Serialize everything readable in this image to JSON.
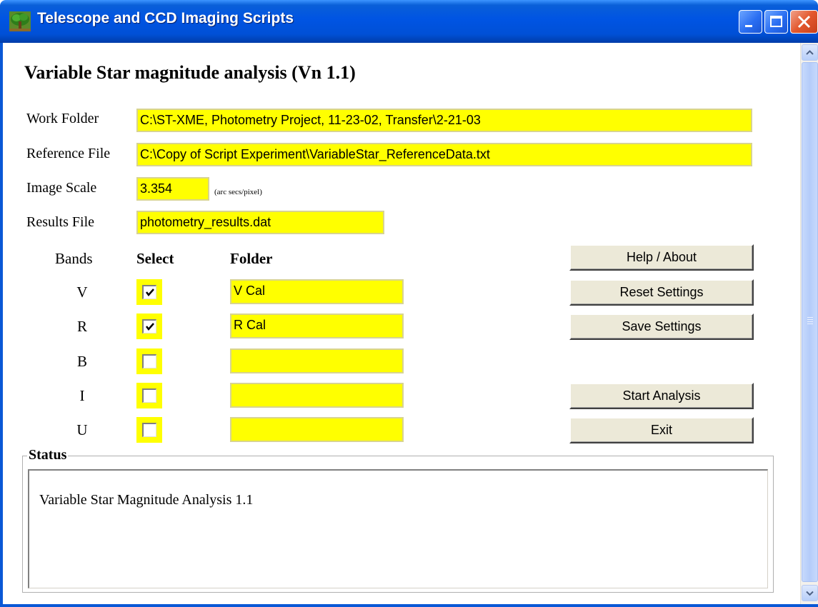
{
  "window": {
    "title": "Telescope and CCD Imaging Scripts"
  },
  "app": {
    "heading": "Variable Star magnitude analysis (Vn 1.1)"
  },
  "fields": {
    "work_folder_label": "Work Folder",
    "work_folder_value": "C:\\ST-XME, Photometry Project, 11-23-02, Transfer\\2-21-03",
    "reference_file_label": "Reference File",
    "reference_file_value": "C:\\Copy of Script Experiment\\VariableStar_ReferenceData.txt",
    "image_scale_label": "Image Scale",
    "image_scale_value": "3.354",
    "image_scale_unit": "(arc secs/pixel)",
    "results_file_label": "Results File",
    "results_file_value": "photometry_results.dat"
  },
  "bands_table": {
    "headers": {
      "bands": "Bands",
      "select": "Select",
      "folder": "Folder"
    },
    "rows": [
      {
        "band": "V",
        "selected": true,
        "folder": "V Cal"
      },
      {
        "band": "R",
        "selected": true,
        "folder": "R Cal"
      },
      {
        "band": "B",
        "selected": false,
        "folder": ""
      },
      {
        "band": "I",
        "selected": false,
        "folder": ""
      },
      {
        "band": "U",
        "selected": false,
        "folder": ""
      }
    ]
  },
  "buttons": {
    "help": "Help / About",
    "reset": "Reset Settings",
    "save": "Save Settings",
    "start": "Start Analysis",
    "exit": "Exit"
  },
  "status": {
    "legend": "Status",
    "text": "Variable Star Magnitude Analysis 1.1"
  },
  "colors": {
    "field_highlight": "#ffff00",
    "titlebar": "#0054e3",
    "button_face": "#ece9d8"
  }
}
